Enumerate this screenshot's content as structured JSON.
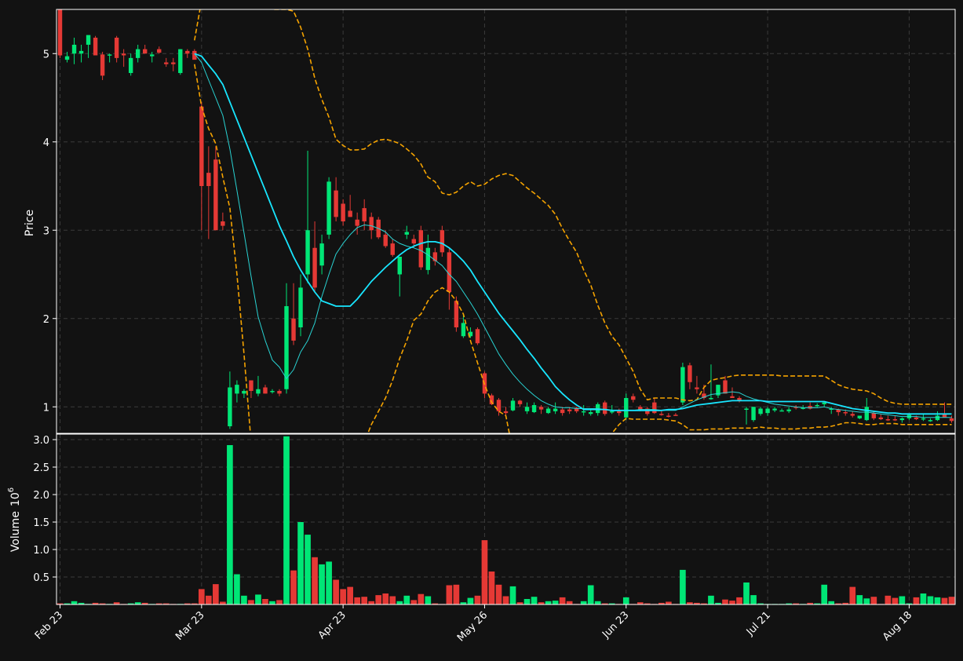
{
  "chart_data": {
    "type": "candlestick",
    "title": "",
    "price_axis": {
      "label": "Price",
      "ylim": [
        0.7,
        5.5
      ],
      "ticks": [
        {
          "value": 1,
          "label": "1"
        },
        {
          "value": 2,
          "label": "2"
        },
        {
          "value": 3,
          "label": "3"
        },
        {
          "value": 4,
          "label": "4"
        },
        {
          "value": 5,
          "label": "5"
        }
      ]
    },
    "volume_axis": {
      "label": "Volume",
      "exponent_label": "6",
      "ylim": [
        0,
        3.1
      ],
      "ticks": [
        {
          "value": 0.5,
          "label": "0.5"
        },
        {
          "value": 1.0,
          "label": "1.0"
        },
        {
          "value": 1.5,
          "label": "1.5"
        },
        {
          "value": 2.0,
          "label": "2.0"
        },
        {
          "value": 2.5,
          "label": "2.5"
        },
        {
          "value": 3.0,
          "label": "3.0"
        }
      ]
    },
    "x_ticks": [
      {
        "index": 0,
        "label": "Feb 23"
      },
      {
        "index": 20,
        "label": "Mar 23"
      },
      {
        "index": 40,
        "label": "Apr 23"
      },
      {
        "index": 60,
        "label": "May 26"
      },
      {
        "index": 80,
        "label": "Jun 23"
      },
      {
        "index": 100,
        "label": "Jul 21"
      },
      {
        "index": 120,
        "label": "Aug 18"
      }
    ],
    "grid": true,
    "colors": {
      "background": "#121212",
      "up": "#00e676",
      "down": "#e53935",
      "ma_fast": "#29d3d3",
      "ma_slow": "#18e6ff",
      "bands": "#f5a300",
      "grid": "#3a3a3a"
    },
    "candles": [
      [
        5.5,
        5.5,
        4.95,
        4.98
      ],
      [
        4.93,
        5.02,
        4.9,
        4.97
      ],
      [
        5.0,
        5.18,
        4.88,
        5.1
      ],
      [
        5.0,
        5.1,
        4.9,
        5.03
      ],
      [
        5.1,
        5.2,
        4.95,
        5.21
      ],
      [
        5.18,
        5.2,
        5.0,
        4.98
      ],
      [
        4.99,
        5.02,
        4.7,
        4.75
      ],
      [
        4.98,
        5.0,
        4.9,
        4.99
      ],
      [
        5.18,
        5.2,
        4.9,
        4.95
      ],
      [
        5.0,
        5.05,
        4.85,
        4.98
      ],
      [
        4.78,
        5.0,
        4.75,
        4.95
      ],
      [
        4.95,
        5.1,
        4.9,
        5.05
      ],
      [
        5.05,
        5.1,
        5.0,
        5.0
      ],
      [
        4.97,
        5.02,
        4.9,
        4.99
      ],
      [
        5.05,
        5.08,
        5.0,
        5.01
      ],
      [
        4.9,
        4.95,
        4.85,
        4.88
      ],
      [
        4.9,
        4.95,
        4.8,
        4.88
      ],
      [
        4.78,
        5.05,
        4.76,
        5.05
      ],
      [
        5.03,
        5.05,
        4.95,
        5.0
      ],
      [
        5.03,
        5.05,
        4.95,
        4.93
      ],
      [
        4.4,
        4.45,
        3.0,
        3.5
      ],
      [
        3.65,
        3.95,
        2.9,
        3.5
      ],
      [
        3.8,
        3.95,
        3.0,
        3.0
      ],
      [
        3.1,
        3.2,
        3.0,
        3.05
      ],
      [
        0.78,
        1.4,
        0.75,
        1.22
      ],
      [
        1.15,
        1.3,
        1.05,
        1.25
      ],
      [
        1.15,
        1.2,
        1.1,
        1.18
      ],
      [
        1.3,
        1.3,
        1.1,
        1.18
      ],
      [
        1.15,
        1.35,
        1.12,
        1.2
      ],
      [
        1.22,
        1.25,
        1.15,
        1.15
      ],
      [
        1.18,
        1.2,
        1.15,
        1.18
      ],
      [
        1.18,
        1.2,
        1.12,
        1.15
      ],
      [
        1.2,
        2.4,
        1.15,
        2.14
      ],
      [
        2.0,
        2.4,
        1.7,
        1.75
      ],
      [
        1.9,
        2.5,
        1.8,
        2.35
      ],
      [
        2.5,
        3.9,
        2.4,
        3.0
      ],
      [
        2.8,
        3.1,
        2.3,
        2.35
      ],
      [
        2.6,
        2.95,
        2.5,
        2.85
      ],
      [
        2.95,
        3.6,
        2.9,
        3.55
      ],
      [
        3.45,
        3.6,
        3.1,
        3.15
      ],
      [
        3.3,
        3.35,
        3.05,
        3.1
      ],
      [
        3.22,
        3.4,
        3.15,
        3.15
      ],
      [
        3.12,
        3.2,
        2.95,
        3.05
      ],
      [
        3.25,
        3.35,
        3.0,
        3.1
      ],
      [
        3.15,
        3.2,
        2.9,
        3.0
      ],
      [
        3.12,
        3.15,
        2.9,
        2.92
      ],
      [
        2.95,
        3.0,
        2.8,
        2.82
      ],
      [
        2.85,
        2.9,
        2.7,
        2.72
      ],
      [
        2.5,
        2.7,
        2.25,
        2.7
      ],
      [
        2.95,
        3.05,
        2.9,
        2.98
      ],
      [
        2.9,
        2.95,
        2.8,
        2.85
      ],
      [
        3.0,
        3.05,
        2.55,
        2.58
      ],
      [
        2.55,
        2.95,
        2.5,
        2.8
      ],
      [
        2.75,
        2.8,
        2.6,
        2.65
      ],
      [
        3.0,
        3.05,
        2.7,
        2.75
      ],
      [
        2.75,
        2.8,
        2.1,
        2.3
      ],
      [
        2.2,
        2.25,
        1.85,
        1.9
      ],
      [
        1.8,
        2.05,
        1.78,
        1.95
      ],
      [
        1.8,
        1.9,
        1.78,
        1.85
      ],
      [
        1.88,
        1.9,
        1.7,
        1.72
      ],
      [
        1.38,
        1.4,
        1.1,
        1.15
      ],
      [
        1.13,
        1.15,
        1.02,
        1.03
      ],
      [
        1.08,
        1.1,
        0.9,
        0.95
      ],
      [
        0.95,
        1.0,
        0.9,
        0.93
      ],
      [
        0.96,
        1.1,
        0.95,
        1.07
      ],
      [
        1.07,
        1.08,
        1.0,
        1.03
      ],
      [
        0.95,
        1.05,
        0.92,
        1.0
      ],
      [
        0.94,
        1.05,
        0.93,
        1.02
      ],
      [
        1.0,
        1.02,
        0.92,
        0.97
      ],
      [
        0.93,
        1.0,
        0.92,
        0.98
      ],
      [
        0.95,
        1.05,
        0.92,
        0.98
      ],
      [
        0.97,
        1.0,
        0.9,
        0.93
      ],
      [
        0.97,
        1.0,
        0.92,
        0.95
      ],
      [
        0.99,
        1.0,
        0.93,
        0.95
      ],
      [
        0.95,
        1.02,
        0.9,
        0.95
      ],
      [
        0.92,
        0.98,
        0.9,
        0.94
      ],
      [
        0.93,
        1.05,
        0.9,
        1.03
      ],
      [
        1.05,
        1.07,
        0.9,
        0.92
      ],
      [
        0.94,
        1.02,
        0.92,
        0.95
      ],
      [
        0.95,
        0.98,
        0.9,
        0.93
      ],
      [
        0.88,
        1.15,
        0.85,
        1.1
      ],
      [
        1.12,
        1.15,
        1.05,
        1.08
      ],
      [
        1.0,
        1.02,
        0.95,
        0.97
      ],
      [
        0.98,
        1.0,
        0.9,
        0.92
      ],
      [
        1.05,
        1.1,
        0.92,
        0.93
      ],
      [
        0.92,
        0.95,
        0.9,
        0.91
      ],
      [
        0.9,
        0.93,
        0.88,
        0.89
      ],
      [
        0.91,
        0.93,
        0.9,
        0.9
      ],
      [
        1.05,
        1.5,
        1.02,
        1.45
      ],
      [
        1.47,
        1.5,
        1.2,
        1.28
      ],
      [
        1.22,
        1.35,
        1.15,
        1.2
      ],
      [
        1.15,
        1.25,
        1.08,
        1.1
      ],
      [
        1.1,
        1.48,
        1.08,
        1.1
      ],
      [
        1.13,
        1.25,
        1.1,
        1.25
      ],
      [
        1.3,
        1.35,
        1.15,
        1.15
      ],
      [
        1.12,
        1.22,
        1.1,
        1.1
      ],
      [
        1.1,
        1.12,
        1.05,
        1.07
      ],
      [
        0.97,
        1.0,
        0.8,
        0.98
      ],
      [
        0.85,
        1.0,
        0.83,
        1.0
      ],
      [
        0.92,
        1.0,
        0.9,
        0.98
      ],
      [
        0.93,
        1.0,
        0.9,
        0.98
      ],
      [
        0.96,
        1.0,
        0.94,
        0.98
      ],
      [
        0.96,
        0.98,
        0.95,
        0.96
      ],
      [
        0.95,
        1.0,
        0.93,
        0.97
      ],
      [
        1.0,
        1.02,
        0.97,
        0.99
      ],
      [
        0.98,
        1.02,
        0.97,
        0.99
      ],
      [
        1.01,
        1.05,
        0.97,
        0.98
      ],
      [
        1.01,
        1.04,
        0.99,
        1.02
      ],
      [
        1.03,
        1.06,
        1.0,
        1.05
      ],
      [
        0.97,
        1.0,
        0.92,
        0.98
      ],
      [
        0.97,
        0.98,
        0.9,
        0.94
      ],
      [
        0.94,
        0.97,
        0.9,
        0.93
      ],
      [
        0.92,
        0.95,
        0.88,
        0.9
      ],
      [
        0.87,
        0.9,
        0.86,
        0.9
      ],
      [
        0.85,
        1.1,
        0.84,
        1.0
      ],
      [
        0.93,
        0.95,
        0.85,
        0.87
      ],
      [
        0.88,
        0.92,
        0.85,
        0.86
      ],
      [
        0.86,
        0.9,
        0.84,
        0.85
      ],
      [
        0.86,
        0.9,
        0.84,
        0.85
      ],
      [
        0.85,
        0.88,
        0.82,
        0.87
      ],
      [
        0.87,
        0.92,
        0.85,
        0.91
      ],
      [
        0.88,
        0.9,
        0.85,
        0.86
      ],
      [
        0.86,
        0.92,
        0.84,
        0.87
      ],
      [
        0.85,
        0.87,
        0.83,
        0.85
      ],
      [
        0.85,
        0.95,
        0.84,
        0.9
      ],
      [
        0.92,
        1.05,
        0.88,
        0.88
      ],
      [
        0.87,
        0.9,
        0.82,
        0.84
      ]
    ],
    "volume_millions": [
      0.02,
      0.02,
      0.06,
      0.03,
      0.01,
      0.03,
      0.02,
      0.01,
      0.04,
      0.01,
      0.02,
      0.04,
      0.03,
      0.01,
      0.02,
      0.02,
      0.01,
      0.01,
      0.02,
      0.02,
      0.28,
      0.16,
      0.37,
      0.05,
      2.9,
      0.55,
      0.16,
      0.08,
      0.18,
      0.1,
      0.06,
      0.08,
      3.06,
      0.62,
      1.5,
      1.27,
      0.86,
      0.73,
      0.78,
      0.45,
      0.28,
      0.32,
      0.13,
      0.14,
      0.06,
      0.17,
      0.2,
      0.15,
      0.06,
      0.16,
      0.08,
      0.19,
      0.15,
      0.02,
      0.01,
      0.35,
      0.36,
      0.04,
      0.12,
      0.16,
      1.17,
      0.6,
      0.36,
      0.15,
      0.33,
      0.04,
      0.1,
      0.14,
      0.04,
      0.06,
      0.07,
      0.13,
      0.06,
      0.01,
      0.06,
      0.35,
      0.06,
      0.02,
      0.02,
      0.01,
      0.13,
      0.01,
      0.04,
      0.02,
      0.01,
      0.03,
      0.05,
      0.01,
      0.63,
      0.04,
      0.03,
      0.02,
      0.16,
      0.03,
      0.09,
      0.07,
      0.13,
      0.4,
      0.17,
      0.02,
      0.01,
      0.01,
      0.01,
      0.02,
      0.02,
      0.01,
      0.03,
      0.02,
      0.36,
      0.06,
      0.02,
      0.03,
      0.32,
      0.17,
      0.11,
      0.14,
      0.01,
      0.16,
      0.12,
      0.15,
      0.02,
      0.13,
      0.2,
      0.15,
      0.13,
      0.12,
      0.14
    ],
    "ma_fast": [
      null,
      null,
      null,
      null,
      null,
      null,
      null,
      null,
      null,
      null,
      null,
      null,
      null,
      null,
      null,
      null,
      null,
      null,
      null,
      5.0,
      4.9,
      4.7,
      4.5,
      4.3,
      3.92,
      3.45,
      2.97,
      2.48,
      2.02,
      1.75,
      1.53,
      1.45,
      1.32,
      1.42,
      1.62,
      1.75,
      1.95,
      2.25,
      2.5,
      2.73,
      2.85,
      2.95,
      3.03,
      3.06,
      3.05,
      3.02,
      2.98,
      2.9,
      2.85,
      2.82,
      2.8,
      2.77,
      2.72,
      2.66,
      2.6,
      2.5,
      2.42,
      2.3,
      2.18,
      2.05,
      1.9,
      1.75,
      1.6,
      1.48,
      1.37,
      1.28,
      1.2,
      1.13,
      1.07,
      1.03,
      1.0,
      0.99,
      0.99,
      0.98,
      0.98,
      0.98,
      0.98,
      0.97,
      0.96,
      0.96,
      0.96,
      0.96,
      0.97,
      0.97,
      0.97,
      0.96,
      0.96,
      0.96,
      1.0,
      1.04,
      1.08,
      1.11,
      1.14,
      1.15,
      1.16,
      1.17,
      1.16,
      1.12,
      1.09,
      1.07,
      1.05,
      1.03,
      1.02,
      1.01,
      1.0,
      0.99,
      0.99,
      0.99,
      1.0,
      0.98,
      0.97,
      0.96,
      0.95,
      0.94,
      0.94,
      0.93,
      0.92,
      0.91,
      0.9,
      0.89,
      0.89,
      0.89,
      0.88,
      0.88,
      0.88,
      0.88,
      0.88
    ],
    "ma_slow": [
      null,
      null,
      null,
      null,
      null,
      null,
      null,
      null,
      null,
      null,
      null,
      null,
      null,
      null,
      null,
      null,
      null,
      null,
      null,
      5.0,
      4.97,
      4.87,
      4.77,
      4.65,
      4.45,
      4.25,
      4.05,
      3.85,
      3.65,
      3.45,
      3.25,
      3.05,
      2.88,
      2.7,
      2.55,
      2.42,
      2.3,
      2.2,
      2.17,
      2.14,
      2.14,
      2.14,
      2.22,
      2.32,
      2.42,
      2.5,
      2.58,
      2.65,
      2.72,
      2.78,
      2.82,
      2.85,
      2.87,
      2.87,
      2.85,
      2.8,
      2.73,
      2.65,
      2.55,
      2.42,
      2.3,
      2.18,
      2.06,
      1.96,
      1.86,
      1.76,
      1.65,
      1.55,
      1.44,
      1.34,
      1.23,
      1.15,
      1.08,
      1.02,
      0.97,
      0.97,
      0.97,
      0.97,
      0.96,
      0.96,
      0.96,
      0.96,
      0.96,
      0.96,
      0.96,
      0.96,
      0.97,
      0.97,
      0.98,
      1.0,
      1.02,
      1.03,
      1.04,
      1.05,
      1.06,
      1.07,
      1.07,
      1.07,
      1.07,
      1.07,
      1.06,
      1.06,
      1.06,
      1.06,
      1.06,
      1.06,
      1.06,
      1.06,
      1.06,
      1.04,
      1.02,
      1.0,
      0.98,
      0.97,
      0.96,
      0.95,
      0.94,
      0.93,
      0.93,
      0.92,
      0.92,
      0.92,
      0.92,
      0.92,
      0.92,
      0.92,
      0.92
    ],
    "band_upper": [
      null,
      null,
      null,
      null,
      null,
      null,
      null,
      null,
      null,
      null,
      null,
      null,
      null,
      null,
      null,
      null,
      null,
      null,
      null,
      5.15,
      5.6,
      6.5,
      7.1,
      7.2,
      6.9,
      6.7,
      6.4,
      6.0,
      5.8,
      5.6,
      5.5,
      5.5,
      5.5,
      5.48,
      5.3,
      5.05,
      4.72,
      4.48,
      4.28,
      4.03,
      3.96,
      3.91,
      3.91,
      3.92,
      3.98,
      4.02,
      4.03,
      4.01,
      3.98,
      3.92,
      3.85,
      3.75,
      3.6,
      3.55,
      3.42,
      3.4,
      3.43,
      3.5,
      3.55,
      3.5,
      3.52,
      3.58,
      3.62,
      3.64,
      3.62,
      3.55,
      3.48,
      3.42,
      3.35,
      3.28,
      3.18,
      3.02,
      2.88,
      2.75,
      2.55,
      2.38,
      2.15,
      1.95,
      1.8,
      1.7,
      1.55,
      1.4,
      1.2,
      1.08,
      1.1,
      1.1,
      1.1,
      1.1,
      1.08,
      1.07,
      1.08,
      1.22,
      1.3,
      1.32,
      1.33,
      1.35,
      1.36,
      1.36,
      1.36,
      1.36,
      1.36,
      1.36,
      1.35,
      1.35,
      1.35,
      1.35,
      1.35,
      1.35,
      1.35,
      1.3,
      1.25,
      1.22,
      1.2,
      1.19,
      1.18,
      1.15,
      1.1,
      1.06,
      1.04,
      1.03,
      1.03,
      1.03,
      1.03,
      1.03,
      1.03,
      1.03,
      1.03
    ],
    "band_lower": [
      null,
      null,
      null,
      null,
      null,
      null,
      null,
      null,
      null,
      null,
      null,
      null,
      null,
      null,
      null,
      null,
      null,
      null,
      null,
      4.88,
      4.4,
      4.15,
      3.98,
      3.6,
      3.25,
      2.5,
      1.6,
      0.6,
      -0.5,
      -1.0,
      -1.2,
      -1.3,
      -1.4,
      -1.5,
      -1.5,
      -1.5,
      -1.4,
      -1.3,
      -1.2,
      -1.1,
      -1.0,
      -0.5,
      0.5,
      0.6,
      0.8,
      0.95,
      1.1,
      1.3,
      1.55,
      1.75,
      1.98,
      2.05,
      2.2,
      2.3,
      2.35,
      2.3,
      2.2,
      2.05,
      1.75,
      1.5,
      1.25,
      1.05,
      0.95,
      0.9,
      0.5,
      0.2,
      -0.2,
      -0.5,
      -0.8,
      -1.1,
      -1.3,
      -1.3,
      -1.2,
      -1.0,
      -0.6,
      -0.3,
      0.0,
      0.4,
      0.7,
      0.8,
      0.87,
      0.86,
      0.86,
      0.86,
      0.86,
      0.86,
      0.85,
      0.84,
      0.8,
      0.74,
      0.74,
      0.74,
      0.75,
      0.75,
      0.75,
      0.76,
      0.76,
      0.76,
      0.76,
      0.77,
      0.76,
      0.76,
      0.75,
      0.75,
      0.75,
      0.76,
      0.76,
      0.77,
      0.77,
      0.78,
      0.8,
      0.82,
      0.82,
      0.81,
      0.8,
      0.8,
      0.81,
      0.81,
      0.81,
      0.8,
      0.8,
      0.8,
      0.8,
      0.8,
      0.8,
      0.8,
      0.8
    ]
  }
}
